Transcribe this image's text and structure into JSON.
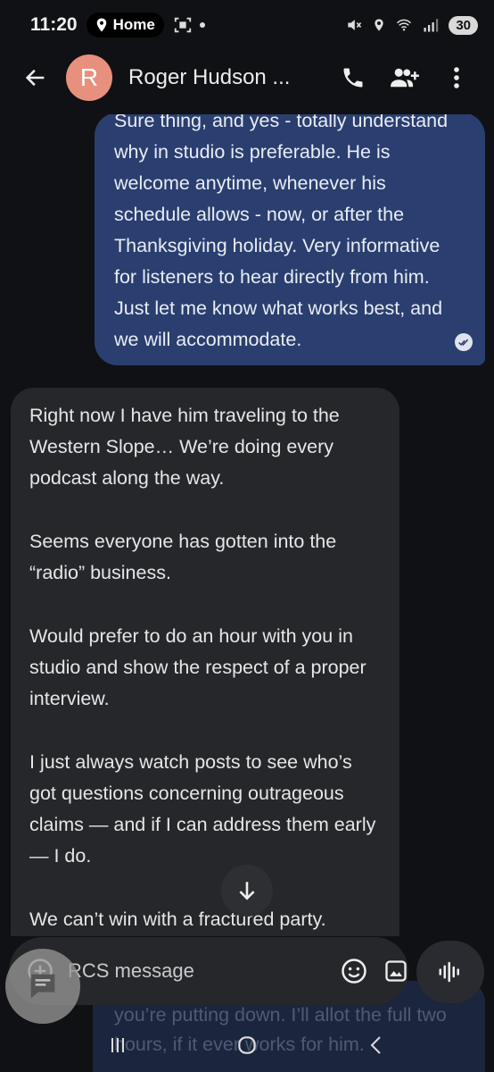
{
  "status_bar": {
    "time": "11:20",
    "location_label": "Home",
    "battery": "30",
    "icons": [
      "home-pin-icon",
      "screenshot-icon",
      "mute-icon",
      "location-icon",
      "wifi-icon",
      "signal-icon"
    ]
  },
  "header": {
    "avatar_letter": "R",
    "contact_name": "Roger Hudson ...",
    "avatar_color": "#e8907e",
    "icons": [
      "back-arrow-icon",
      "phone-icon",
      "add-person-icon",
      "more-vert-icon"
    ]
  },
  "messages": {
    "outgoing": {
      "text": "Sure thing, and yes - totally understand why in studio is preferable. He is welcome anytime, whenever his schedule allows - now, or after the Thanksgiving holiday. Very informative for listeners to hear directly from him. Just let me know what works best, and we will accommodate.",
      "status_icon": "read-check-icon",
      "bubble_color": "#2a3f6f"
    },
    "incoming": {
      "paragraphs": [
        "Right now I have him traveling to the Western Slope… We’re doing every podcast along the way.",
        "Seems everyone has gotten into the “radio” business.",
        "Would prefer to do an hour with you in studio and show the respect of a proper interview.",
        "I just always watch posts to see who’s got questions concerning outrageous claims — and if I can address them early — I do.",
        "We can’t win with a fractured party."
      ],
      "bubble_color": "#26272b"
    },
    "behind_compose": {
      "text": "you’re putting down. I’ll allot the full two hours, if it ever works for him."
    }
  },
  "compose": {
    "placeholder": "RCS message",
    "icons": [
      "add-circle-icon",
      "emoji-icon",
      "gallery-icon",
      "voice-wave-icon"
    ]
  },
  "overlays": {
    "chat_head_icon": "chat-bubble-icon",
    "scroll_icon": "arrow-down-icon"
  },
  "nav": {
    "icons": [
      "recents-icon",
      "home-icon",
      "back-icon"
    ]
  }
}
